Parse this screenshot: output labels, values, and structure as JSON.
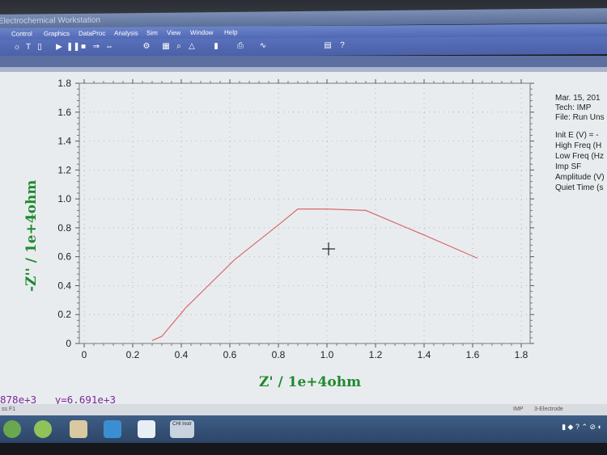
{
  "window": {
    "title": "Electrochemical Workstation"
  },
  "menu": [
    "Control",
    "Graphics",
    "DataProc",
    "Analysis",
    "Sim",
    "View",
    "Window",
    "Help"
  ],
  "toolbar_icons": [
    "font-icon",
    "text-icon",
    "run-icon",
    "pause-icon",
    "stop-icon",
    "arrow-icon",
    "zoom-icon",
    "search-icon",
    "graph-icon",
    "print-icon",
    "help-icon"
  ],
  "info_panel": {
    "date": "Mar. 15, 201",
    "tech": "Tech: IMP",
    "file": "File: Run Uns",
    "params": [
      "Init E (V) = -",
      "High Freq (H",
      "Low Freq (Hz",
      "Imp SF",
      "Amplitude (V)",
      "Quiet Time (s"
    ]
  },
  "cursor_readout": {
    "x_text": "878e+3",
    "y_text": "y=6.691e+3"
  },
  "status": {
    "left": "ss F1",
    "mode": "IMP",
    "electrode": "3-Electrode"
  },
  "taskbar": {
    "app_label": "CHI Instr"
  },
  "colors": {
    "curve": "#d96a6a",
    "axis_label": "#1f8a2f",
    "readout": "#7a2a9a"
  },
  "chart_data": {
    "type": "line",
    "xlabel": "Z' / 1e+4ohm",
    "ylabel": "-Z'' / 1e+4ohm",
    "xlim": [
      0,
      1.8
    ],
    "ylim": [
      0,
      1.8
    ],
    "x_ticks": [
      "0",
      "0.2",
      "0.4",
      "0.6",
      "0.8",
      "1.0",
      "1.2",
      "1.4",
      "1.6",
      "1.8"
    ],
    "y_ticks": [
      "0",
      "0.2",
      "0.4",
      "0.6",
      "0.8",
      "1.0",
      "1.2",
      "1.4",
      "1.6",
      "1.8"
    ],
    "grid": true,
    "series": [
      {
        "x": [
          0.28,
          0.32,
          0.42,
          0.62,
          0.8,
          0.88,
          1.0,
          1.16,
          1.4,
          1.62
        ],
        "y": [
          0.02,
          0.05,
          0.25,
          0.58,
          0.82,
          0.93,
          0.93,
          0.92,
          0.75,
          0.59
        ]
      }
    ]
  }
}
